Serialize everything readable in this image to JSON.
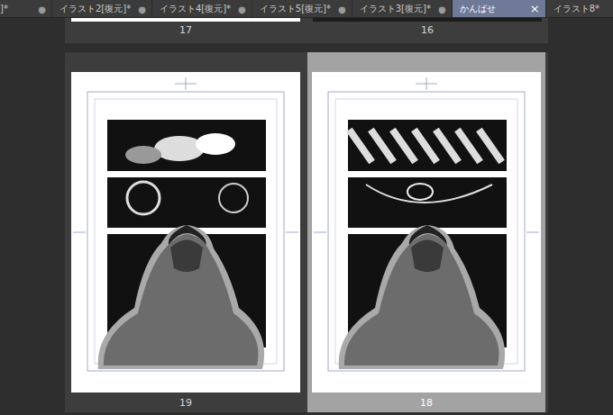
{
  "tabs": [
    {
      "label": "]*",
      "marker": "●",
      "selected": false
    },
    {
      "label": "イラスト2[復元]*",
      "marker": "●",
      "selected": false
    },
    {
      "label": "イラスト4[復元]*",
      "marker": "●",
      "selected": false
    },
    {
      "label": "イラスト5[復元]*",
      "marker": "●",
      "selected": false
    },
    {
      "label": "イラスト3[復元]*",
      "marker": "●",
      "selected": false
    },
    {
      "label": "かんばせ",
      "marker": "×",
      "selected": true
    },
    {
      "label": "イラスト8*",
      "marker": "",
      "selected": false
    }
  ],
  "top_pages": [
    {
      "number": "17"
    },
    {
      "number": "16"
    }
  ],
  "pages": [
    {
      "number": "19",
      "selected": false
    },
    {
      "number": "18",
      "selected": true
    }
  ]
}
